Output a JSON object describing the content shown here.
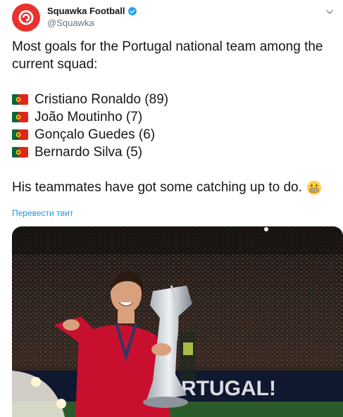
{
  "author": {
    "display_name": "Squawka Football",
    "handle": "@Squawka",
    "verified": true,
    "avatar_icon": "squawka-logo-icon",
    "brand_color": "#e8322c"
  },
  "tweet": {
    "intro": "Most goals for the Portugal national team among the current squad:",
    "players": [
      {
        "flag_icon": "portugal-flag-icon",
        "text": "Cristiano Ronaldo (89)"
      },
      {
        "flag_icon": "portugal-flag-icon",
        "text": "João Moutinho (7)"
      },
      {
        "flag_icon": "portugal-flag-icon",
        "text": "Gonçalo Guedes (6)"
      },
      {
        "flag_icon": "portugal-flag-icon",
        "text": "Bernardo Silva (5)"
      }
    ],
    "outro": "His teammates have got some catching up to do.",
    "outro_emoji": "grimacing-face-icon",
    "translate_label": "Перевести твит"
  },
  "media": {
    "description_icon": "trophy-celebration-photo",
    "banner_text": "RTUGAL!"
  },
  "colors": {
    "link": "#1b95e0",
    "text": "#14171a",
    "secondary": "#657786",
    "flag_green": "#046a38",
    "flag_red": "#da291c"
  }
}
